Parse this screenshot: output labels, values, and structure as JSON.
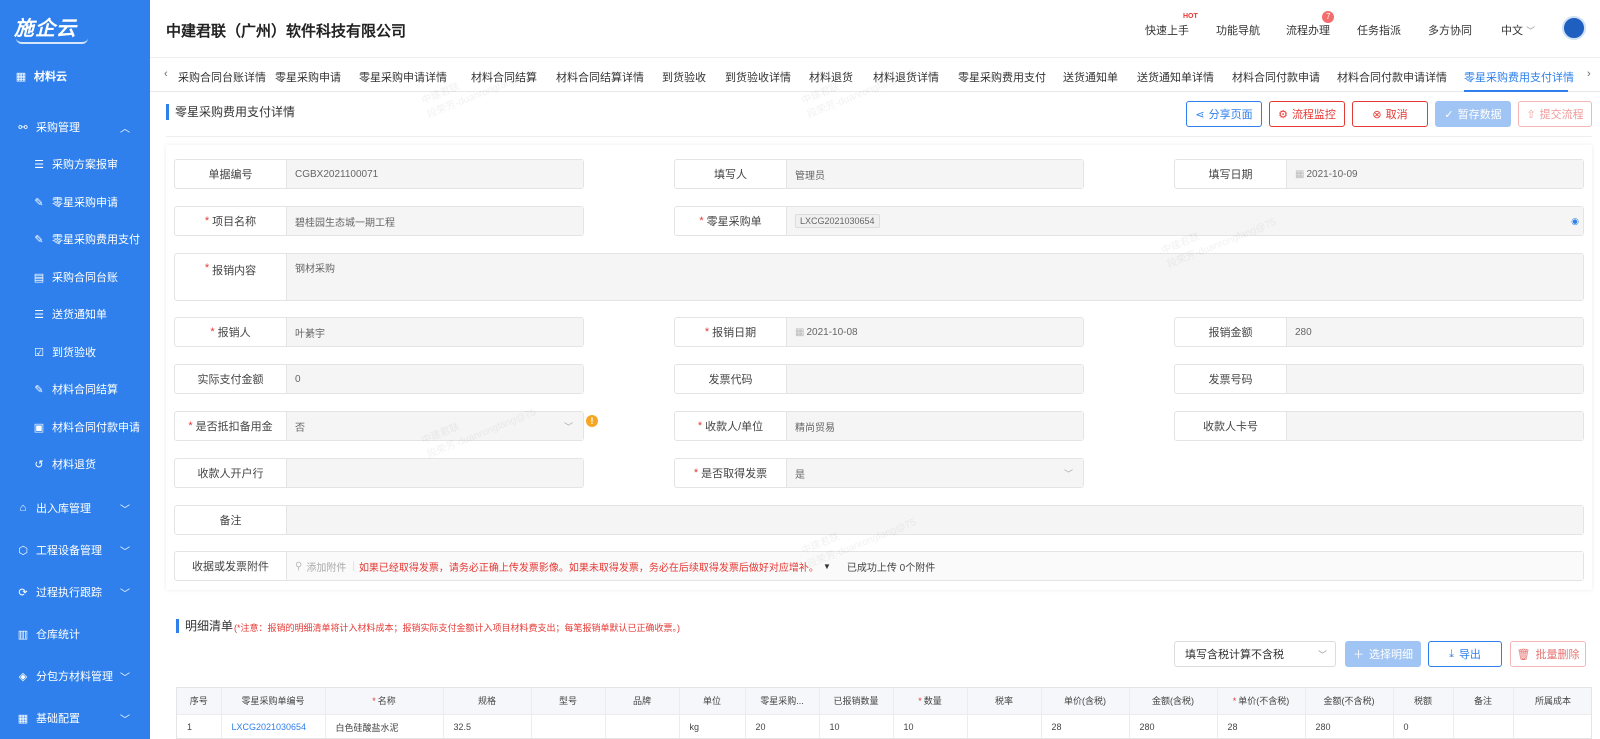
{
  "brand": {
    "logo": "施企云"
  },
  "sidebar": {
    "top": {
      "label": "材料云",
      "icon": "grid-icon"
    },
    "groups": [
      {
        "label": "采购管理",
        "icon": "org-icon",
        "expanded": true,
        "items": [
          {
            "label": "采购方案报审"
          },
          {
            "label": "零星采购申请"
          },
          {
            "label": "零星采购费用支付"
          },
          {
            "label": "采购合同台账"
          },
          {
            "label": "送货通知单"
          },
          {
            "label": "到货验收"
          },
          {
            "label": "材料合同结算"
          },
          {
            "label": "材料合同付款申请"
          },
          {
            "label": "材料退货"
          }
        ]
      },
      {
        "label": "出入库管理",
        "icon": "home-icon"
      },
      {
        "label": "工程设备管理",
        "icon": "box-icon"
      },
      {
        "label": "过程执行跟踪",
        "icon": "cycle-icon"
      },
      {
        "label": "仓库统计",
        "icon": "stats-icon"
      },
      {
        "label": "分包方材料管理",
        "icon": "wallet-icon"
      },
      {
        "label": "基础配置",
        "icon": "grid-icon"
      }
    ]
  },
  "header": {
    "company": "中建君联（广州）软件科技有限公司",
    "nav": {
      "quick": "快速上手",
      "quick_hot": "HOT",
      "func": "功能导航",
      "flow": "流程办理",
      "flow_badge": "7",
      "task": "任务指派",
      "collab": "多方协同",
      "lang": "中文"
    }
  },
  "tabs": [
    "采购合同台账详情",
    "零星采购申请",
    "零星采购申请详情",
    "材料合同结算",
    "材料合同结算详情",
    "到货验收",
    "到货验收详情",
    "材料退货",
    "材料退货详情",
    "零星采购费用支付",
    "送货通知单",
    "送货通知单详情",
    "材料合同付款申请",
    "材料合同付款申请详情",
    "零星采购费用支付详情"
  ],
  "page": {
    "title": "零星采购费用支付详情",
    "buttons": {
      "share": "分享页面",
      "monitor": "流程监控",
      "cancel": "取消",
      "save": "暂存数据",
      "submit": "提交流程"
    }
  },
  "form": {
    "doc_no": {
      "label": "单据编号",
      "value": "CGBX2021100071"
    },
    "filler": {
      "label": "填写人",
      "value": "管理员"
    },
    "fill_date": {
      "label": "填写日期",
      "value": "2021-10-09"
    },
    "project": {
      "label": "项目名称",
      "value": "碧桂园生态城一期工程"
    },
    "po": {
      "label": "零星采购单",
      "value": "LXCG2021030654"
    },
    "content": {
      "label": "报销内容",
      "value": "钢材采购"
    },
    "claimant": {
      "label": "报销人",
      "value": "叶綦宇"
    },
    "claim_date": {
      "label": "报销日期",
      "value": "2021-10-08"
    },
    "claim_amount": {
      "label": "报销金额",
      "value": "280"
    },
    "actual_amount": {
      "label": "实际支付金额",
      "value": "0"
    },
    "invoice_code": {
      "label": "发票代码",
      "value": ""
    },
    "invoice_no": {
      "label": "发票号码",
      "value": ""
    },
    "deduct": {
      "label": "是否抵扣备用金",
      "value": "否"
    },
    "payee": {
      "label": "收款人/单位",
      "value": "精尚贸易"
    },
    "payee_card": {
      "label": "收款人卡号",
      "value": ""
    },
    "bank": {
      "label": "收款人开户行",
      "value": ""
    },
    "got_invoice": {
      "label": "是否取得发票",
      "value": "是"
    },
    "remark": {
      "label": "备注",
      "value": ""
    },
    "attach": {
      "label": "收据或发票附件",
      "add": "添加附件",
      "note": "如果已经取得发票，请务必正确上传发票影像。如果未取得发票，务必在后续取得发票后做好对应增补。",
      "status": "已成功上传 0个附件"
    }
  },
  "detail": {
    "title": "明细清单",
    "note": "(*注意：报销的明细清单将计入材料成本；报销实际支付金额计入项目材料费支出；每笔报销单默认已正确收票。)",
    "select": "填写含税计算不含税",
    "buttons": {
      "choose": "选择明细",
      "export": "导出",
      "batch_delete": "批量删除"
    },
    "columns": [
      "序号",
      "零星采购单编号",
      "名称",
      "规格",
      "型号",
      "品牌",
      "单位",
      "零星采购...",
      "已报销数量",
      "数量",
      "税率",
      "单价(含税)",
      "金额(含税)",
      "单价(不含税)",
      "金额(不含税)",
      "税额",
      "备注",
      "所属成本"
    ],
    "rows": [
      [
        "1",
        "LXCG2021030654",
        "白色硅酸盐水泥",
        "32.5",
        "",
        "",
        "kg",
        "20",
        "10",
        "10",
        "",
        "28",
        "280",
        "28",
        "280",
        "0",
        "",
        ""
      ]
    ]
  },
  "watermark": {
    "line1": "中建君联",
    "line2": "段荣芳-duanrongfang@75"
  },
  "colors": {
    "primary": "#2f80ec",
    "danger": "#e53935",
    "warning": "#f5a623"
  }
}
